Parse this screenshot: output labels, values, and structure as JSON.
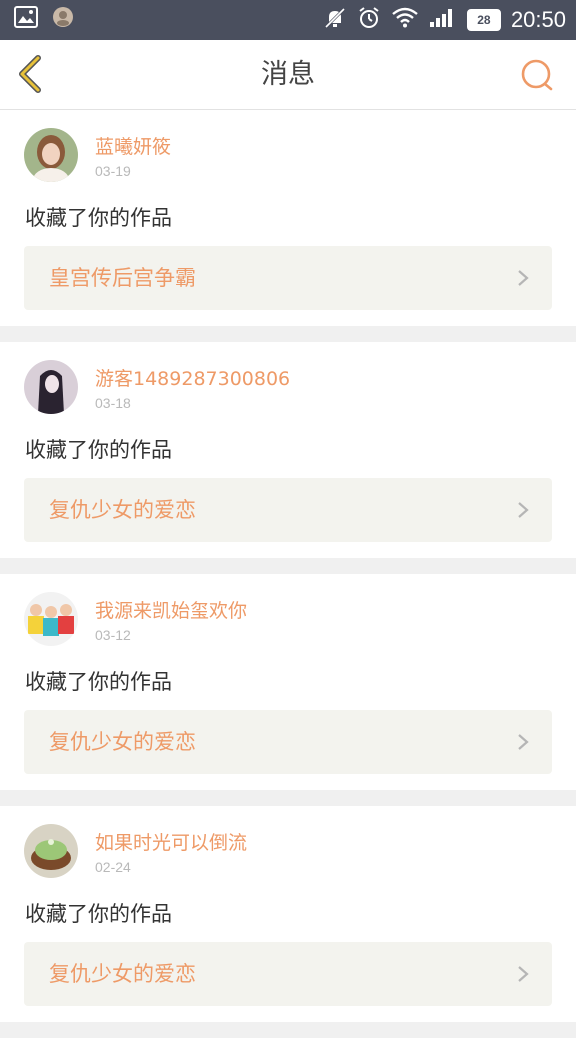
{
  "status_bar": {
    "time": "20:50",
    "battery": "28"
  },
  "header": {
    "title": "消息"
  },
  "messages": [
    {
      "username": "蓝曦妍筱",
      "date": "03-19",
      "action": "收藏了你的作品",
      "work": "皇宫传后宫争霸"
    },
    {
      "username": "游客1489287300806",
      "date": "03-18",
      "action": "收藏了你的作品",
      "work": "复仇少女的爱恋"
    },
    {
      "username": "我源来凯始玺欢你",
      "date": "03-12",
      "action": "收藏了你的作品",
      "work": "复仇少女的爱恋"
    },
    {
      "username": "如果时光可以倒流",
      "date": "02-24",
      "action": "收藏了你的作品",
      "work": "复仇少女的爱恋"
    }
  ],
  "colors": {
    "accent": "#ee9a67",
    "status_bar": "#4a4f5e",
    "back_arrow": "#e8c23a"
  }
}
